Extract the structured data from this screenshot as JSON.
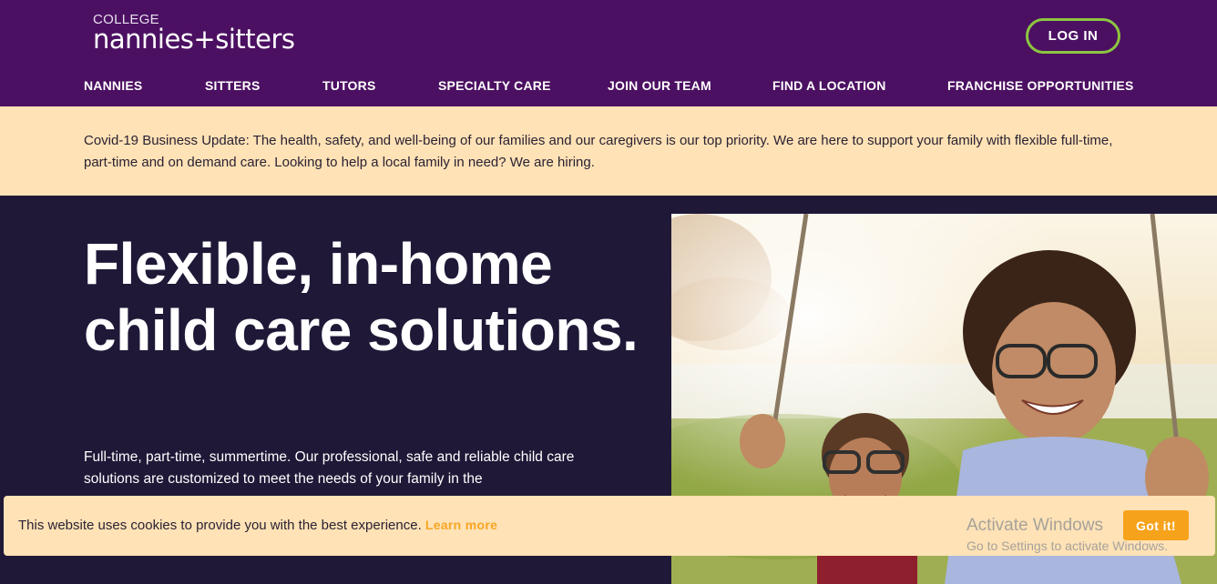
{
  "brand": {
    "logo_top": "COLLEGE",
    "logo_main": "nannies+sitters"
  },
  "header": {
    "login_label": "LOG IN"
  },
  "nav": {
    "items": [
      {
        "label": "NANNIES"
      },
      {
        "label": "SITTERS"
      },
      {
        "label": "TUTORS"
      },
      {
        "label": "SPECIALTY CARE"
      },
      {
        "label": "JOIN OUR TEAM"
      },
      {
        "label": "FIND A LOCATION"
      },
      {
        "label": "FRANCHISE OPPORTUNITIES"
      }
    ]
  },
  "banner": {
    "text": "Covid-19 Business Update: The health, safety, and well-being of our families and our caregivers is our top priority. We are here to support your family with flexible full-time, part-time and on demand care. Looking to help a local family in need? We are hiring."
  },
  "hero": {
    "title": "Flexible, in-home child care solutions.",
    "body": "Full-time, part-time, summertime. Our professional, safe and reliable child care solutions are customized to meet the needs of your family in the"
  },
  "cookie": {
    "message": "This website uses cookies to provide you with the best experience.",
    "learn_more": "Learn more",
    "button": "Got it!"
  },
  "watermark": {
    "title": "Activate Windows",
    "subtitle": "Go to Settings to activate Windows."
  },
  "colors": {
    "header_bg": "#4c1062",
    "hero_bg": "#1f1837",
    "banner_bg": "#ffe2b6",
    "login_border": "#8cc63f",
    "accent_orange": "#f7a21b"
  }
}
